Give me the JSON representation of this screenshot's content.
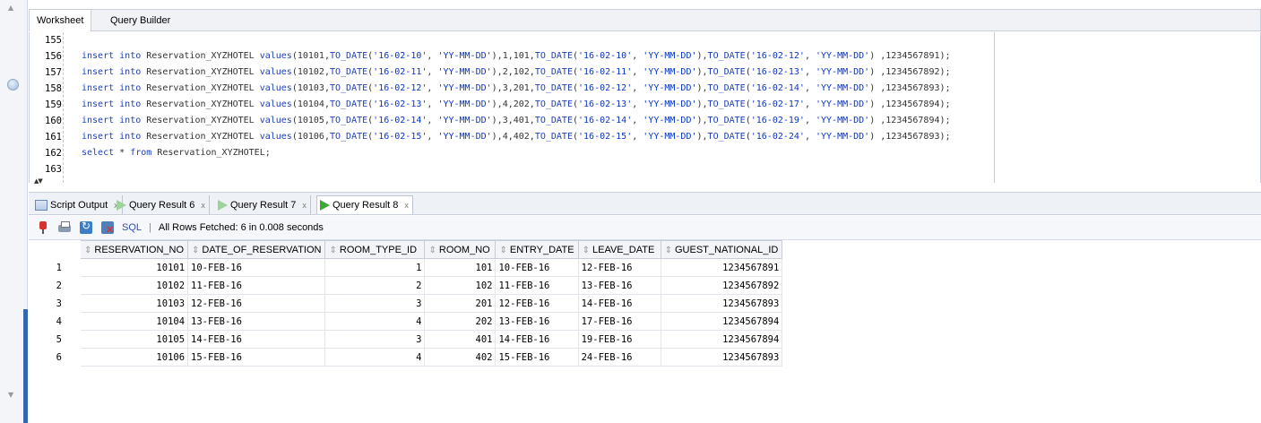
{
  "editor": {
    "tabs": [
      "Worksheet",
      "Query Builder"
    ],
    "lines": [
      {
        "no": "155",
        "text": ""
      },
      {
        "no": "156",
        "text": "insert into Reservation_XYZHOTEL values(10101,TO_DATE('16-02-10', 'YY-MM-DD'),1,101,TO_DATE('16-02-10', 'YY-MM-DD'),TO_DATE('16-02-12', 'YY-MM-DD') ,1234567891);"
      },
      {
        "no": "157",
        "text": "insert into Reservation_XYZHOTEL values(10102,TO_DATE('16-02-11', 'YY-MM-DD'),2,102,TO_DATE('16-02-11', 'YY-MM-DD'),TO_DATE('16-02-13', 'YY-MM-DD') ,1234567892);"
      },
      {
        "no": "158",
        "text": "insert into Reservation_XYZHOTEL values(10103,TO_DATE('16-02-12', 'YY-MM-DD'),3,201,TO_DATE('16-02-12', 'YY-MM-DD'),TO_DATE('16-02-14', 'YY-MM-DD') ,1234567893);"
      },
      {
        "no": "159",
        "text": "insert into Reservation_XYZHOTEL values(10104,TO_DATE('16-02-13', 'YY-MM-DD'),4,202,TO_DATE('16-02-13', 'YY-MM-DD'),TO_DATE('16-02-17', 'YY-MM-DD') ,1234567894);"
      },
      {
        "no": "160",
        "text": "insert into Reservation_XYZHOTEL values(10105,TO_DATE('16-02-14', 'YY-MM-DD'),3,401,TO_DATE('16-02-14', 'YY-MM-DD'),TO_DATE('16-02-19', 'YY-MM-DD') ,1234567894);"
      },
      {
        "no": "161",
        "text": "insert into Reservation_XYZHOTEL values(10106,TO_DATE('16-02-15', 'YY-MM-DD'),4,402,TO_DATE('16-02-15', 'YY-MM-DD'),TO_DATE('16-02-24', 'YY-MM-DD') ,1234567893);"
      },
      {
        "no": "162",
        "text": "select * from Reservation_XYZHOTEL;"
      },
      {
        "no": "163",
        "text": ""
      }
    ]
  },
  "output_tabs": [
    {
      "label": "Script Output",
      "icon": "script-icon"
    },
    {
      "label": "Query Result 6",
      "icon": "play-icon"
    },
    {
      "label": "Query Result 7",
      "icon": "play-icon"
    },
    {
      "label": "Query Result 8",
      "icon": "play-icon"
    }
  ],
  "tab_close": "x",
  "toolbar": {
    "sql_label": "SQL",
    "separator": "|",
    "status": "All Rows Fetched: 6 in 0.008 seconds"
  },
  "grid": {
    "columns": [
      "RESERVATION_NO",
      "DATE_OF_RESERVATION",
      "ROOM_TYPE_ID",
      "ROOM_NO",
      "ENTRY_DATE",
      "LEAVE_DATE",
      "GUEST_NATIONAL_ID"
    ],
    "rows": [
      [
        "1",
        "10101",
        "10-FEB-16",
        "1",
        "101",
        "10-FEB-16",
        "12-FEB-16",
        "1234567891"
      ],
      [
        "2",
        "10102",
        "11-FEB-16",
        "2",
        "102",
        "11-FEB-16",
        "13-FEB-16",
        "1234567892"
      ],
      [
        "3",
        "10103",
        "12-FEB-16",
        "3",
        "201",
        "12-FEB-16",
        "14-FEB-16",
        "1234567893"
      ],
      [
        "4",
        "10104",
        "13-FEB-16",
        "4",
        "202",
        "13-FEB-16",
        "17-FEB-16",
        "1234567894"
      ],
      [
        "5",
        "10105",
        "14-FEB-16",
        "3",
        "401",
        "14-FEB-16",
        "19-FEB-16",
        "1234567894"
      ],
      [
        "6",
        "10106",
        "15-FEB-16",
        "4",
        "402",
        "15-FEB-16",
        "24-FEB-16",
        "1234567893"
      ]
    ]
  },
  "colors": {
    "keyword": "#1e3fb5",
    "string": "#0a36c6",
    "run_icon": "#3aa935",
    "accent_bar": "#3566b0"
  }
}
